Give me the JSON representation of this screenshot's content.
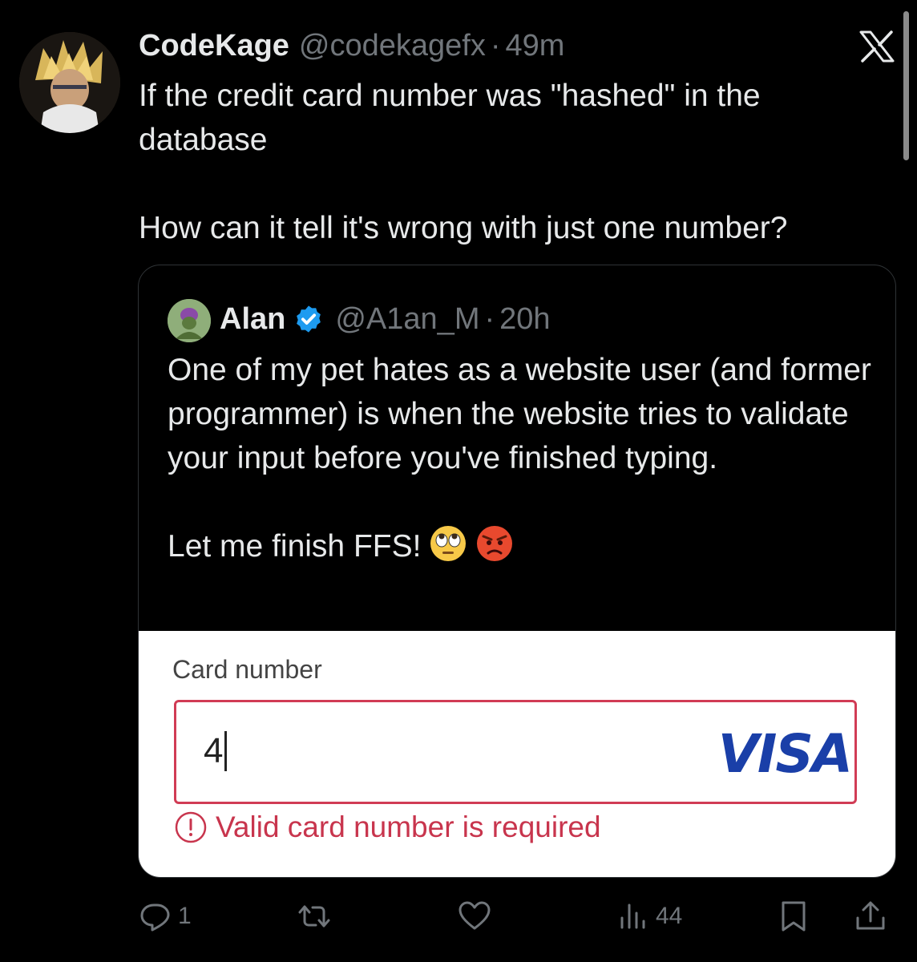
{
  "tweet": {
    "author": {
      "name": "CodeKage",
      "handle": "@codekagefx",
      "separator": "·",
      "time": "49m"
    },
    "text_lines": [
      "If the credit card number was \"hashed\" in the database",
      "How can it tell it's wrong with just one number?"
    ]
  },
  "quote": {
    "author": {
      "name": "Alan",
      "handle": "@A1an_M",
      "separator": "·",
      "time": "20h",
      "verified": true
    },
    "text_lines": [
      "One of my pet hates as a website user (and former programmer) is when the website tries to validate your input before you've finished typing.",
      "Let me finish FFS!"
    ],
    "emojis": [
      "face-with-rolling-eyes",
      "pouting-face"
    ]
  },
  "card_form": {
    "label": "Card number",
    "value": "4",
    "brand": "VISA",
    "error": "Valid card number is required"
  },
  "actions": {
    "reply_count": "1",
    "retweet_count": "",
    "like_count": "",
    "views_count": "44"
  },
  "colors": {
    "background": "#000000",
    "text_primary": "#e7e9ea",
    "text_secondary": "#71767b",
    "verified_blue": "#1d9bf0",
    "error_red": "#d13c55",
    "visa_blue": "#1a3fa8"
  }
}
